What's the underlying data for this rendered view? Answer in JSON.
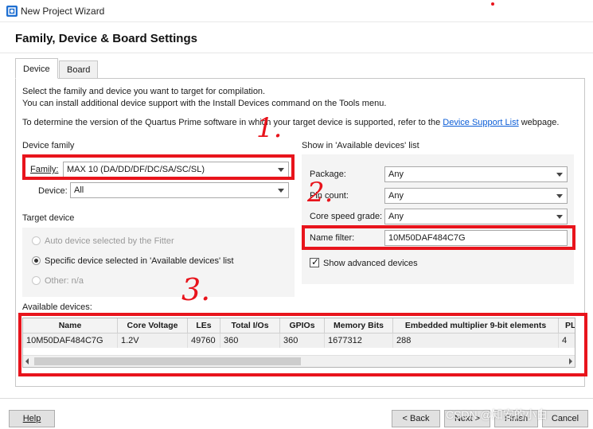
{
  "window": {
    "title": "New Project Wizard",
    "icon": "quartus-app-icon"
  },
  "page": {
    "title": "Family, Device & Board Settings"
  },
  "tabs": [
    {
      "label": "Device",
      "active": true
    },
    {
      "label": "Board",
      "active": false
    }
  ],
  "intro": {
    "line1": "Select the family and device you want to target for compilation.",
    "line2": "You can install additional device support with the Install Devices command on the Tools menu.",
    "line3_before": "To determine the version of the Quartus Prime software in which your target device is supported, refer to the",
    "line3_link": "Device Support List",
    "line3_after": "webpage."
  },
  "device_family": {
    "group_label": "Device family",
    "family_label": "Family:",
    "family_value": "MAX 10 (DA/DD/DF/DC/SA/SC/SL)",
    "device_label": "Device:",
    "device_value": "All"
  },
  "target_device": {
    "group_label": "Target device",
    "options": [
      {
        "label": "Auto device selected by the Fitter",
        "checked": false,
        "enabled": false
      },
      {
        "label": "Specific device selected in 'Available devices' list",
        "checked": true,
        "enabled": true
      },
      {
        "label": "Other:",
        "suffix": "n/a",
        "checked": false,
        "enabled": false
      }
    ]
  },
  "show_in_list": {
    "group_label": "Show in 'Available devices' list",
    "package_label": "Package:",
    "package_value": "Any",
    "pin_count_label": "Pin count:",
    "pin_count_value": "Any",
    "speed_label": "Core speed grade:",
    "speed_value": "Any",
    "name_filter_label": "Name filter:",
    "name_filter_value": "10M50DAF484C7G",
    "show_advanced_label": "Show advanced devices",
    "show_advanced_checked": true
  },
  "available_devices": {
    "label": "Available devices:",
    "columns": [
      "Name",
      "Core Voltage",
      "LEs",
      "Total I/Os",
      "GPIOs",
      "Memory Bits",
      "Embedded multiplier 9-bit elements",
      "PL"
    ],
    "rows": [
      [
        "10M50DAF484C7G",
        "1.2V",
        "49760",
        "360",
        "360",
        "1677312",
        "288",
        "4"
      ]
    ]
  },
  "annotations": {
    "one": "1.",
    "two": "2.",
    "three": "3.",
    "color": "#e8141c"
  },
  "buttons": {
    "help": "Help",
    "back": "< Back",
    "next": "Next >",
    "finish": "Finish",
    "cancel": "Cancel"
  },
  "watermark": "CSDN @知安的小白"
}
